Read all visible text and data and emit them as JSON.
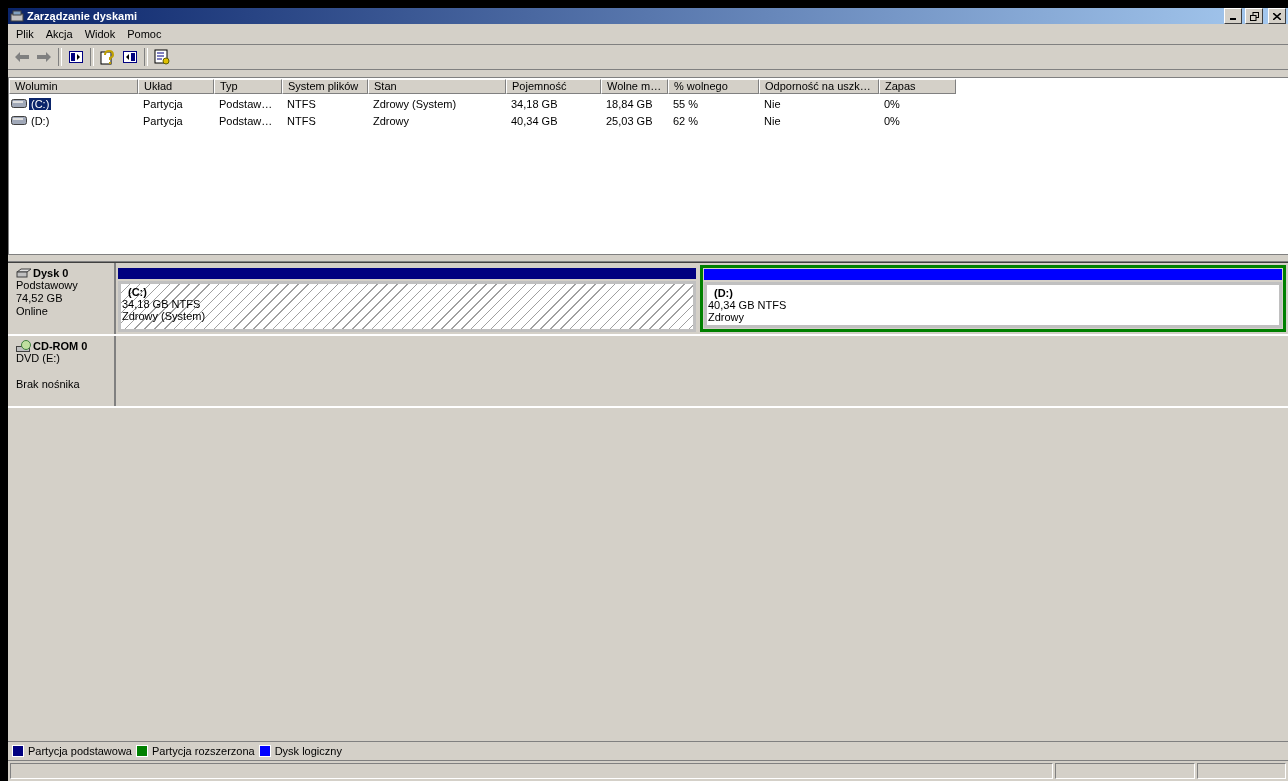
{
  "window": {
    "title": "Zarządzanie dyskami"
  },
  "menu": [
    "Plik",
    "Akcja",
    "Widok",
    "Pomoc"
  ],
  "toolbar": [
    {
      "kind": "back",
      "disabled": true
    },
    {
      "kind": "forward",
      "disabled": true
    },
    {
      "kind": "sep"
    },
    {
      "kind": "panel"
    },
    {
      "kind": "sep"
    },
    {
      "kind": "help"
    },
    {
      "kind": "panel2"
    },
    {
      "kind": "sep"
    },
    {
      "kind": "props"
    }
  ],
  "table": {
    "columns": [
      "Wolumin",
      "Układ",
      "Typ",
      "System plików",
      "Stan",
      "Pojemność",
      "Wolne m…",
      "% wolnego",
      "Odporność na uszk…",
      "Zapas"
    ],
    "rows": [
      {
        "selected": true,
        "cells": [
          "(C:)",
          "Partycja",
          "Podstaw…",
          "NTFS",
          "Zdrowy (System)",
          "34,18 GB",
          "18,84 GB",
          "55 %",
          "Nie",
          "0%"
        ]
      },
      {
        "selected": false,
        "cells": [
          "(D:)",
          "Partycja",
          "Podstaw…",
          "NTFS",
          "Zdrowy",
          "40,34 GB",
          "25,03 GB",
          "62 %",
          "Nie",
          "0%"
        ]
      }
    ]
  },
  "disks": [
    {
      "kind": "disk",
      "name": "Dysk 0",
      "lines": [
        "Podstawowy",
        "74,52 GB",
        "Online"
      ],
      "partitions": [
        {
          "kind": "primary",
          "label": "(C:)",
          "size": "34,18 GB NTFS",
          "status": "Zdrowy (System)"
        },
        {
          "kind": "logical",
          "label": "(D:)",
          "size": "40,34 GB NTFS",
          "status": "Zdrowy"
        }
      ]
    },
    {
      "kind": "cdrom",
      "name": "CD-ROM 0",
      "lines": [
        "DVD (E:)"
      ],
      "media": "Brak nośnika"
    }
  ],
  "legend": [
    {
      "label": "Partycja podstawowa",
      "color": "#000080"
    },
    {
      "label": "Partycja rozszerzona",
      "color": "#008000"
    },
    {
      "label": "Dysk logiczny",
      "color": "#0000ff"
    }
  ]
}
